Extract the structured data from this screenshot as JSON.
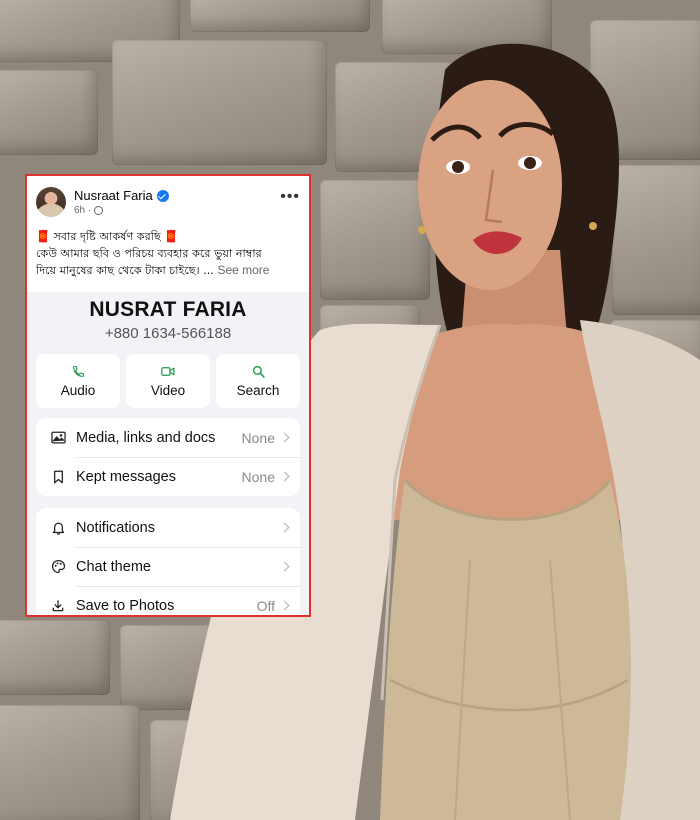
{
  "post": {
    "author": "Nusraat Faria",
    "time": "6h ·",
    "more_label": "•••",
    "line1": "🧧 সবার দৃষ্টি আকর্ষণ করছি 🧧",
    "line2": "কেউ আমার ছবি ও পরিচয় ব্যবহার করে ভুয়া নাম্বার",
    "line3": "দিয়ে মানুষের কাছ থেকে টাকা চাইছে। ...",
    "see_more": "See more"
  },
  "contact": {
    "name": "NUSRAT FARIA",
    "phone": "+880 1634-566188",
    "actions": [
      {
        "label": "Audio",
        "icon": "phone-icon"
      },
      {
        "label": "Video",
        "icon": "video-icon"
      },
      {
        "label": "Search",
        "icon": "search-icon"
      }
    ],
    "group1": [
      {
        "label": "Media, links and docs",
        "value": "None",
        "icon": "image-icon"
      },
      {
        "label": "Kept messages",
        "value": "None",
        "icon": "bookmark-icon"
      }
    ],
    "group2": [
      {
        "label": "Notifications",
        "value": "",
        "icon": "bell-icon"
      },
      {
        "label": "Chat theme",
        "value": "",
        "icon": "palette-icon"
      },
      {
        "label": "Save to Photos",
        "value": "Off",
        "icon": "download-icon"
      }
    ]
  },
  "colors": {
    "frame_border": "#e0302f",
    "accent_green": "#1f9a4a",
    "verified_blue": "#1877f2"
  }
}
